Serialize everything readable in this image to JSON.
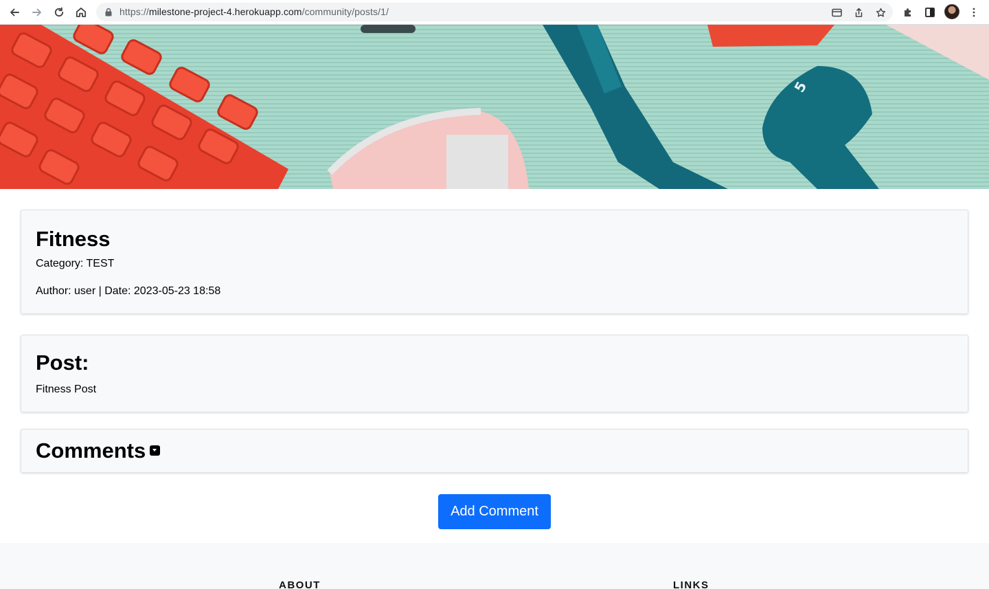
{
  "browser": {
    "url_scheme": "https://",
    "url_host": "milestone-project-4.herokuapp.com",
    "url_path": "/community/posts/1/"
  },
  "post": {
    "title": "Fitness",
    "category": "Category: TEST",
    "meta": "Author: user | Date: 2023-05-23 18:58"
  },
  "post_body": {
    "heading": "Post:",
    "content": "Fitness Post"
  },
  "comments": {
    "heading": "Comments"
  },
  "actions": {
    "add_comment": "Add Comment"
  },
  "footer": {
    "about": "ABOUT",
    "links": "LINKS"
  },
  "colors": {
    "primary": "#0d6efd",
    "card_background": "#f8f9fa",
    "card_border": "#dee2e6",
    "hero_mat": "#a6d6c8",
    "foam_roller": "#ee4232",
    "dumbbell": "#126a78"
  },
  "icons": {
    "back": "arrow-left-icon",
    "forward": "arrow-right-icon",
    "reload": "reload-icon",
    "home": "home-icon",
    "lock": "lock-icon",
    "card": "card-icon",
    "share": "share-icon",
    "star": "star-icon",
    "extensions": "puzzle-icon",
    "side_panel": "side-panel-icon",
    "menu": "more-vertical-icon",
    "comments_toggle": "caret-down-square-icon"
  }
}
